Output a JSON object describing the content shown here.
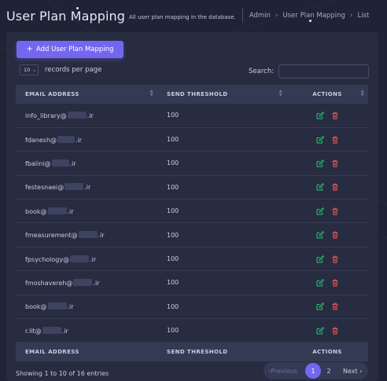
{
  "header": {
    "title": "User Plan Mapping",
    "subtitle": "All user plan mapping in the database.",
    "breadcrumbs": [
      "Admin",
      "User Plan Mapping",
      "List"
    ]
  },
  "toolbar": {
    "add_button_label": "Add User Plan Mapping",
    "length_value": "10",
    "length_label": "records per page",
    "search_label": "Search:",
    "search_value": ""
  },
  "table": {
    "columns": [
      "EMAIL ADDRESS",
      "SEND THRESHOLD",
      "ACTIONS"
    ],
    "rows": [
      {
        "email_prefix": "info_library@",
        "email_suffix": ".ir",
        "threshold": "100"
      },
      {
        "email_prefix": "fdanesh@",
        "email_suffix": ".ir",
        "threshold": "100"
      },
      {
        "email_prefix": "fbalini@",
        "email_suffix": ".ir",
        "threshold": "100"
      },
      {
        "email_prefix": "festesnaei@",
        "email_suffix": ".ir",
        "threshold": "100"
      },
      {
        "email_prefix": "book@",
        "email_suffix": ".ir",
        "threshold": "100"
      },
      {
        "email_prefix": "fmeasurement@",
        "email_suffix": ".ir",
        "threshold": "100"
      },
      {
        "email_prefix": "fpsychology@",
        "email_suffix": ".ir",
        "threshold": "100"
      },
      {
        "email_prefix": "fmoshavereh@",
        "email_suffix": ".ir",
        "threshold": "100"
      },
      {
        "email_prefix": "book@",
        "email_suffix": ".ir",
        "threshold": "100"
      },
      {
        "email_prefix": "r.lit@",
        "email_suffix": ".ir",
        "threshold": "100"
      }
    ]
  },
  "footer": {
    "info": "Showing 1 to 10 of 16 entries",
    "previous_label": "Previous",
    "next_label": "Next",
    "pages": [
      "1",
      "2"
    ],
    "active_page": "1"
  },
  "colors": {
    "accent": "#7367f0",
    "edit": "#28c76f",
    "delete": "#ea5455",
    "background": "#1f2336",
    "card": "#272c41"
  },
  "icons": {
    "edit": "edit-icon",
    "delete": "trash-icon",
    "add": "plus-icon",
    "breadcrumb_separator": "chevron-right-icon"
  }
}
